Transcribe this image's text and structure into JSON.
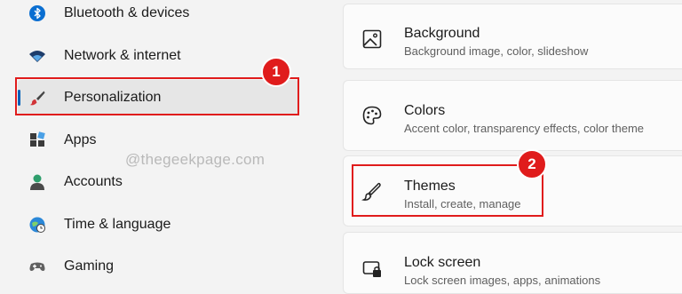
{
  "sidebar": {
    "items": [
      {
        "label": "Bluetooth & devices",
        "icon": "bluetooth-icon"
      },
      {
        "label": "Network & internet",
        "icon": "wifi-icon"
      },
      {
        "label": "Personalization",
        "icon": "paintbrush-icon",
        "selected": true
      },
      {
        "label": "Apps",
        "icon": "apps-icon"
      },
      {
        "label": "Accounts",
        "icon": "person-icon"
      },
      {
        "label": "Time & language",
        "icon": "globe-clock-icon"
      },
      {
        "label": "Gaming",
        "icon": "gamepad-icon"
      }
    ]
  },
  "annotations": {
    "badge1": "1",
    "badge2": "2",
    "color": "#e01c1c"
  },
  "watermark": "@thegeekpage.com",
  "cards": [
    {
      "title": "Background",
      "subtitle": "Background image, color, slideshow",
      "icon": "image-icon"
    },
    {
      "title": "Colors",
      "subtitle": "Accent color, transparency effects, color theme",
      "icon": "palette-icon"
    },
    {
      "title": "Themes",
      "subtitle": "Install, create, manage",
      "icon": "brush-icon"
    },
    {
      "title": "Lock screen",
      "subtitle": "Lock screen images, apps, animations",
      "icon": "lock-screen-icon"
    }
  ],
  "colors": {
    "accent": "#005fb8",
    "background": "#f3f3f3",
    "card": "#fbfbfb"
  }
}
